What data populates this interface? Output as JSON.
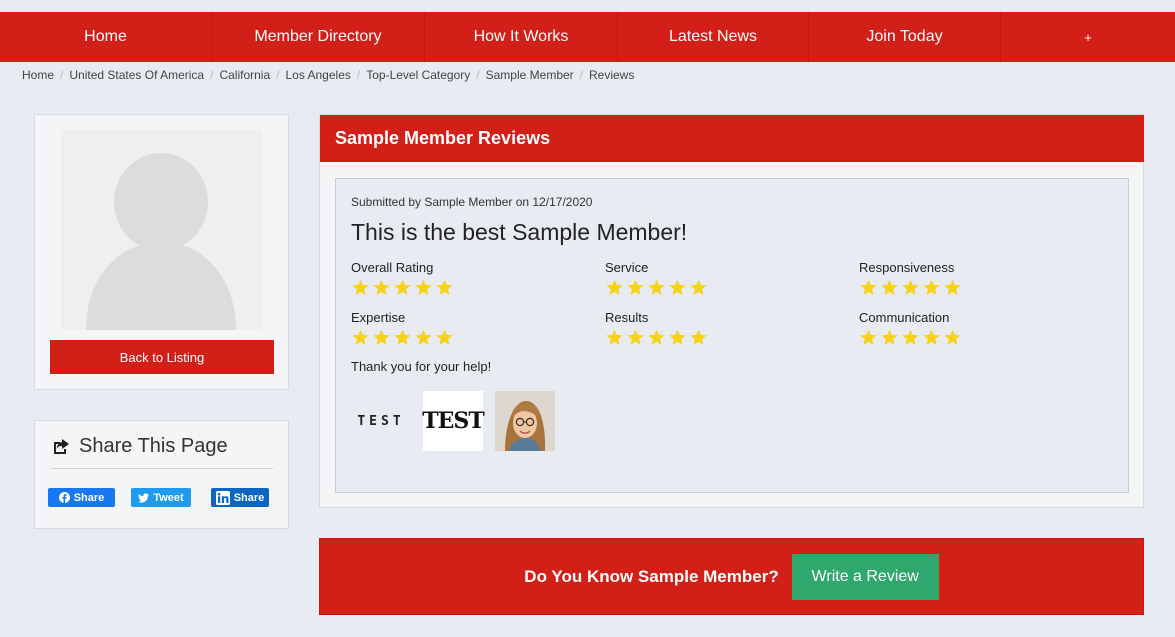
{
  "nav": {
    "items": [
      {
        "label": "Home"
      },
      {
        "label": "Member Directory"
      },
      {
        "label": "How It Works"
      },
      {
        "label": "Latest News"
      },
      {
        "label": "Join Today"
      },
      {
        "label": "+"
      }
    ]
  },
  "breadcrumb": [
    "Home",
    "United States Of America",
    "California",
    "Los Angeles",
    "Top-Level Category",
    "Sample Member",
    "Reviews"
  ],
  "profile": {
    "avatar_icon": "user-silhouette-icon",
    "back_label": "Back to Listing"
  },
  "share": {
    "title": "Share This Page",
    "icon": "share-icon",
    "facebook_label": "Share",
    "twitter_label": "Tweet",
    "linkedin_label": "Share"
  },
  "reviews": {
    "header": "Sample Member Reviews",
    "submitted": "Submitted by Sample Member on 12/17/2020",
    "title": "This is the best Sample Member!",
    "ratings": [
      {
        "label": "Overall Rating",
        "stars": 5,
        "max": 5
      },
      {
        "label": "Service",
        "stars": 5,
        "max": 5
      },
      {
        "label": "Responsiveness",
        "stars": 5,
        "max": 5
      },
      {
        "label": "Expertise",
        "stars": 5,
        "max": 5
      },
      {
        "label": "Results",
        "stars": 5,
        "max": 5
      },
      {
        "label": "Communication",
        "stars": 5,
        "max": 5
      }
    ],
    "text": "Thank you for your help!",
    "thumbnails": [
      {
        "text": "TEST"
      },
      {
        "text": "TEST"
      },
      {
        "text": ""
      }
    ]
  },
  "cta": {
    "text": "Do You Know Sample Member?",
    "button": "Write a Review"
  },
  "colors": {
    "brand_red": "#d21f18",
    "cta_green": "#2fa86e",
    "star_yellow": "#f7d21b",
    "page_bg": "#e8ecf2"
  }
}
